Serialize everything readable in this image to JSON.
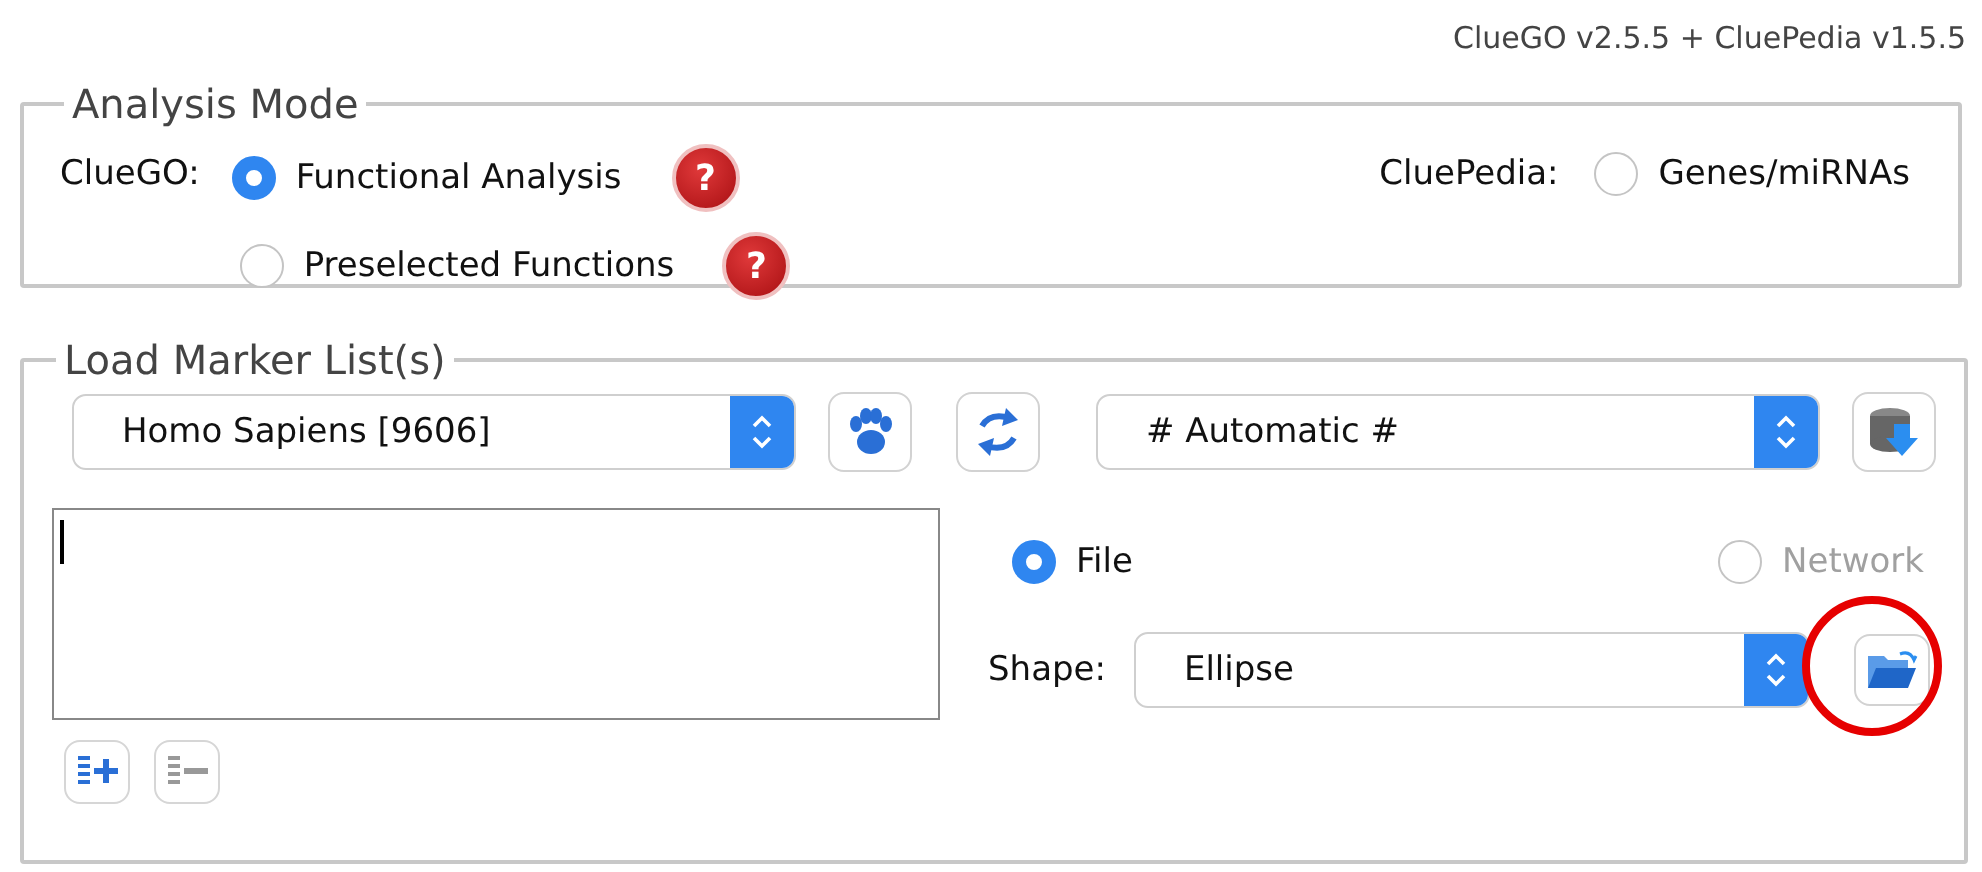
{
  "version": "ClueGO v2.5.5 + CluePedia v1.5.5",
  "analysis_mode": {
    "title": "Analysis Mode",
    "cluego_label": "ClueGO:",
    "cluego_options": [
      {
        "label": "Functional Analysis",
        "selected": true,
        "help": "?"
      },
      {
        "label": "Preselected Functions",
        "selected": false,
        "help": "?"
      }
    ],
    "cluepedia_label": "CluePedia:",
    "cluepedia_option": {
      "label": "Genes/miRNAs",
      "selected": false
    }
  },
  "load_marker": {
    "title": "Load Marker List(s)",
    "organism": "Homo Sapiens [9606]",
    "id_type": "# Automatic #",
    "source_options": [
      {
        "label": "File",
        "selected": true,
        "disabled": false
      },
      {
        "label": "Network",
        "selected": false,
        "disabled": true
      }
    ],
    "shape_label": "Shape:",
    "shape": "Ellipse",
    "folder_button": {
      "highlighted": true
    }
  }
}
